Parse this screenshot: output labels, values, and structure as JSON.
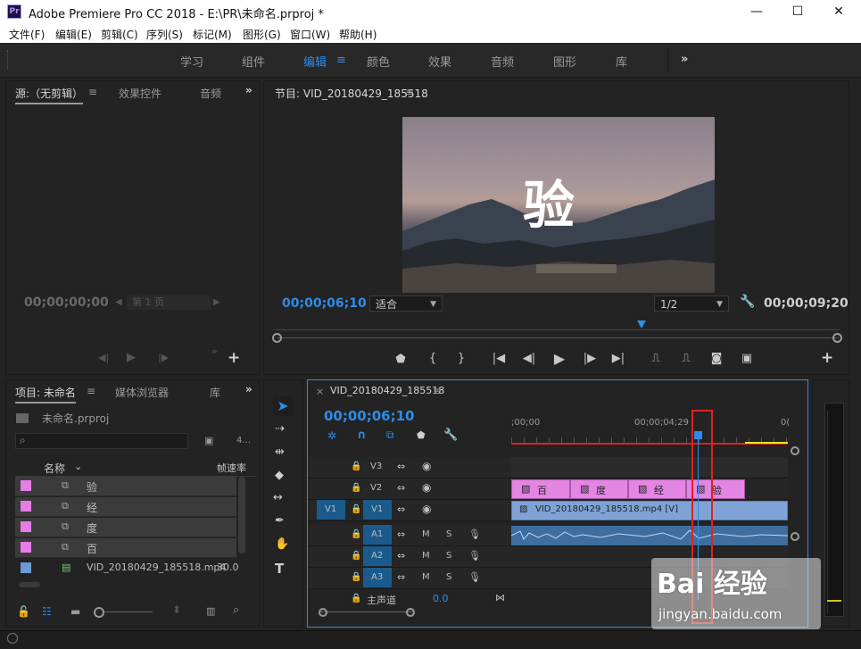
{
  "window": {
    "title": "Adobe Premiere Pro CC 2018 - E:\\PR\\未命名.prproj *",
    "app_icon": "Pr",
    "minimize": "—",
    "maximize": "☐",
    "close": "✕"
  },
  "menu": [
    "文件(F)",
    "编辑(E)",
    "剪辑(C)",
    "序列(S)",
    "标记(M)",
    "图形(G)",
    "窗口(W)",
    "帮助(H)"
  ],
  "workspaces": {
    "items": [
      "学习",
      "组件",
      "编辑",
      "颜色",
      "效果",
      "音频",
      "图形",
      "库"
    ],
    "active": "编辑",
    "more": "»"
  },
  "source_panel": {
    "tabs": [
      "源:（无剪辑）",
      "效果控件",
      "音频"
    ],
    "timecode_left": "00;00;00;00",
    "page_label": "第 1 页"
  },
  "program_panel": {
    "title": "节目: VID_20180429_185518",
    "overlay_char": "验",
    "timecode_current": "00;00;06;10",
    "fit_label": "适合",
    "resolution_label": "1/2",
    "timecode_duration": "00;00;09;20",
    "playhead_fraction": 0.65
  },
  "project_panel": {
    "tabs": [
      "项目: 未命名",
      "媒体浏览器",
      "库"
    ],
    "project_file": "未命名.prproj",
    "item_count": "4...",
    "col_name": "名称",
    "col_fps": "帧速率",
    "items": [
      {
        "name": "验",
        "color": "#e67de6",
        "fps": ""
      },
      {
        "name": "经",
        "color": "#e67de6",
        "fps": ""
      },
      {
        "name": "度",
        "color": "#e67de6",
        "fps": ""
      },
      {
        "name": "百",
        "color": "#e67de6",
        "fps": ""
      },
      {
        "name": "VID_20180429_185518.mp4",
        "color": "#6b9bd2",
        "fps": "30.0"
      }
    ]
  },
  "timeline": {
    "sequence_name": "VID_20180429_185518",
    "timecode": "00;00;06;10",
    "ruler_start": ";00;00",
    "ruler_mid": "00;00;04;29",
    "ruler_end": "0(",
    "video_tracks": [
      "V3",
      "V2",
      "V1"
    ],
    "audio_tracks": [
      "A1",
      "A2",
      "A3"
    ],
    "source_patch_v": "V1",
    "master_label": "主声道",
    "master_value": "0.0",
    "v2_clips": [
      "百",
      "度",
      "经",
      "验"
    ],
    "v1_clip": "VID_20180429_185518.mp4 [V]",
    "track_buttons": {
      "mute": "M",
      "solo": "S"
    }
  },
  "watermark": {
    "brand": "Bai 经验",
    "url": "jingyan.baidu.com"
  }
}
